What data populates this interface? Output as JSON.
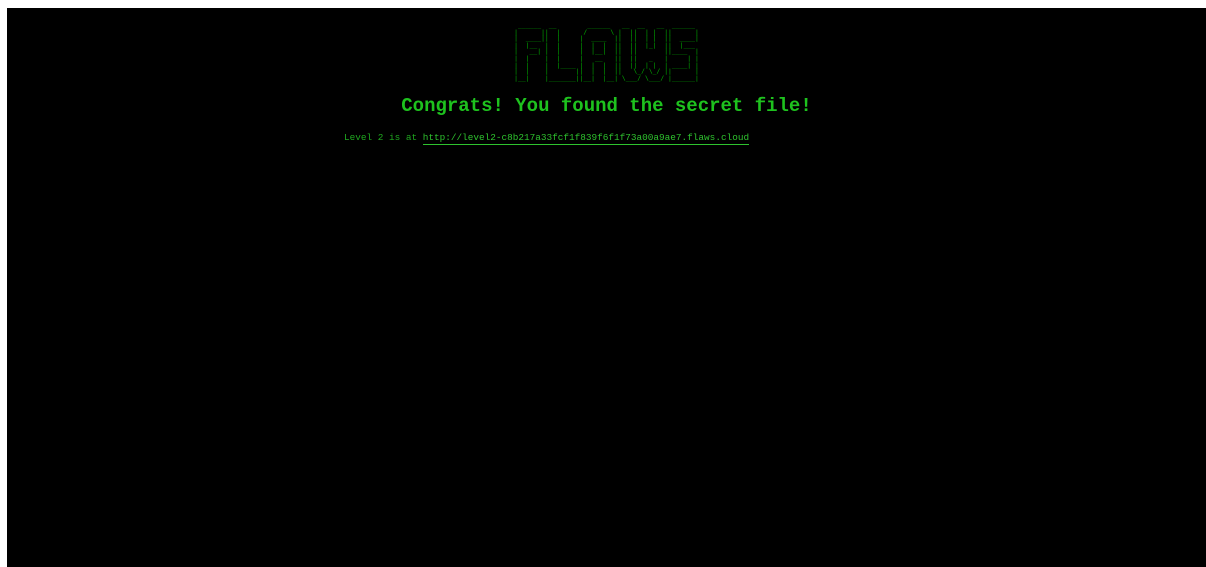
{
  "logo": {
    "text": "FLAWS"
  },
  "heading": "Congrats! You found the secret file!",
  "level": {
    "prefix": "Level 2 is at ",
    "link_text": "http://level2-c8b217a33fcf1f839f6f1f73a00a9ae7.flaws.cloud"
  },
  "colors": {
    "background": "#000000",
    "heading": "#1ec21e",
    "text": "#1fa81f",
    "link": "#2ec22e",
    "logo": "#00b000"
  }
}
